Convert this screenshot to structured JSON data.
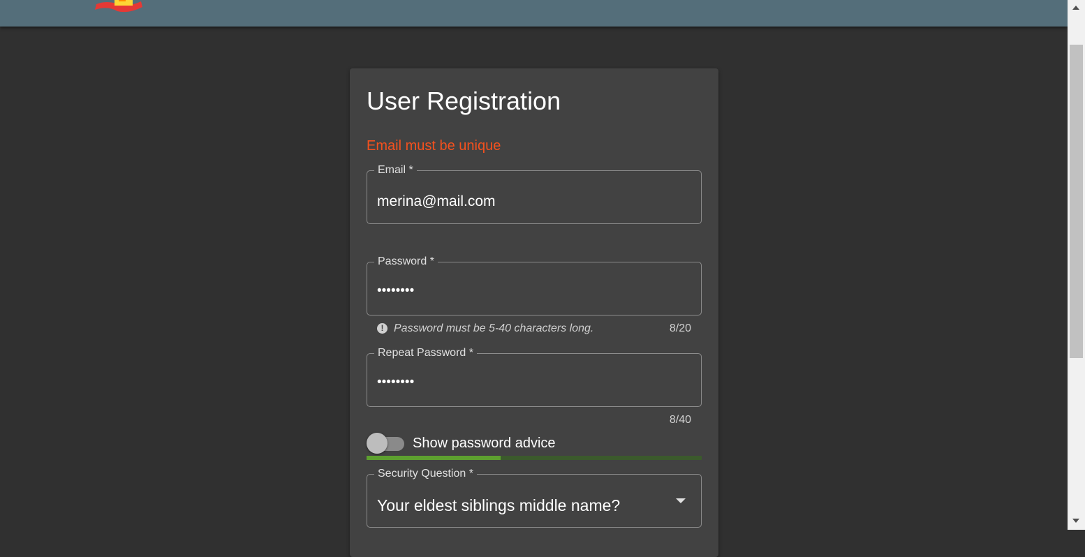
{
  "form": {
    "title": "User Registration",
    "error": "Email must be unique",
    "email": {
      "label": "Email *",
      "value": "merina@mail.com"
    },
    "password": {
      "label": "Password *",
      "value": "••••••••",
      "hint": "Password must be 5-40 characters long.",
      "counter": "8/20"
    },
    "repeat_password": {
      "label": "Repeat Password *",
      "value": "••••••••",
      "counter": "8/40"
    },
    "advice_toggle": {
      "label": "Show password advice",
      "on": false
    },
    "strength": {
      "fraction": 0.4,
      "fill_color": "#5da02f",
      "track_color": "#3b5a2c"
    },
    "security_question": {
      "label": "Security Question *",
      "value": "Your eldest siblings middle name?"
    }
  },
  "colors": {
    "header": "#546e7a",
    "background": "#303030",
    "card": "#424242",
    "error": "#f4511e"
  },
  "icons": {
    "hint": "exclamation-circle-icon",
    "dropdown": "chevron-down-icon",
    "logo": "logo-icon"
  }
}
